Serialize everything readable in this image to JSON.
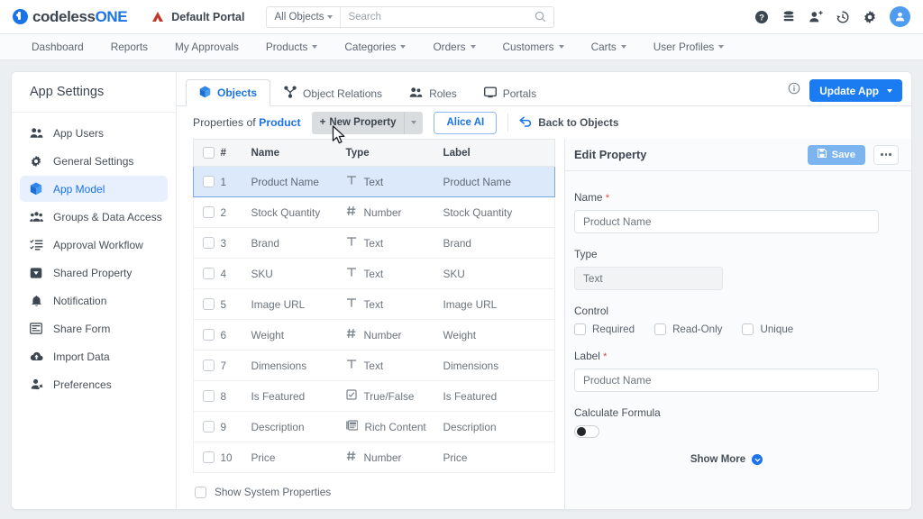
{
  "brand": {
    "name_part1": "codeless",
    "name_part2": "ONE",
    "accent": "#1a73e8"
  },
  "topbar": {
    "portal_name": "Default Portal",
    "search_scope": "All Objects",
    "search_placeholder": "Search",
    "search_value": "",
    "icons": [
      "help-icon",
      "database-icon",
      "add-user-icon",
      "history-icon",
      "gear-icon",
      "avatar"
    ]
  },
  "nav": {
    "items": [
      {
        "label": "Dashboard",
        "has_caret": false
      },
      {
        "label": "Reports",
        "has_caret": false
      },
      {
        "label": "My Approvals",
        "has_caret": false
      },
      {
        "label": "Products",
        "has_caret": true
      },
      {
        "label": "Categories",
        "has_caret": true
      },
      {
        "label": "Orders",
        "has_caret": true
      },
      {
        "label": "Customers",
        "has_caret": true
      },
      {
        "label": "Carts",
        "has_caret": true
      },
      {
        "label": "User Profiles",
        "has_caret": true
      }
    ]
  },
  "sidebar": {
    "title": "App Settings",
    "items": [
      {
        "label": "App Users",
        "icon": "users-icon",
        "active": false
      },
      {
        "label": "General Settings",
        "icon": "gear-icon",
        "active": false
      },
      {
        "label": "App Model",
        "icon": "cube-icon",
        "active": true
      },
      {
        "label": "Groups & Data Access",
        "icon": "group-icon",
        "active": false
      },
      {
        "label": "Approval Workflow",
        "icon": "checklist-icon",
        "active": false
      },
      {
        "label": "Shared Property",
        "icon": "tag-icon",
        "active": false
      },
      {
        "label": "Notification",
        "icon": "bell-icon",
        "active": false
      },
      {
        "label": "Share Form",
        "icon": "form-icon",
        "active": false
      },
      {
        "label": "Import Data",
        "icon": "cloud-upload-icon",
        "active": false
      },
      {
        "label": "Preferences",
        "icon": "person-gear-icon",
        "active": false
      }
    ]
  },
  "tabs": [
    {
      "label": "Objects",
      "icon": "cube-icon",
      "active": true
    },
    {
      "label": "Object Relations",
      "icon": "relations-icon",
      "active": false
    },
    {
      "label": "Roles",
      "icon": "users-icon",
      "active": false
    },
    {
      "label": "Portals",
      "icon": "monitor-icon",
      "active": false
    }
  ],
  "header_actions": {
    "info_icon": "info-icon",
    "update_app_label": "Update App"
  },
  "toolbar": {
    "properties_of": "Properties of",
    "object_name": "Product",
    "new_property_label": "New Property",
    "alice_ai_label": "Alice AI",
    "back_to_objects_label": "Back to Objects"
  },
  "table": {
    "columns": [
      "#",
      "Name",
      "Type",
      "Label"
    ],
    "rows": [
      {
        "num": "1",
        "name": "Product Name",
        "type": "Text",
        "type_icon": "text-icon",
        "label": "Product Name",
        "selected": true
      },
      {
        "num": "2",
        "name": "Stock Quantity",
        "type": "Number",
        "type_icon": "number-icon",
        "label": "Stock Quantity",
        "selected": false
      },
      {
        "num": "3",
        "name": "Brand",
        "type": "Text",
        "type_icon": "text-icon",
        "label": "Brand",
        "selected": false
      },
      {
        "num": "4",
        "name": "SKU",
        "type": "Text",
        "type_icon": "text-icon",
        "label": "SKU",
        "selected": false
      },
      {
        "num": "5",
        "name": "Image URL",
        "type": "Text",
        "type_icon": "text-icon",
        "label": "Image URL",
        "selected": false
      },
      {
        "num": "6",
        "name": "Weight",
        "type": "Number",
        "type_icon": "number-icon",
        "label": "Weight",
        "selected": false
      },
      {
        "num": "7",
        "name": "Dimensions",
        "type": "Text",
        "type_icon": "text-icon",
        "label": "Dimensions",
        "selected": false
      },
      {
        "num": "8",
        "name": "Is Featured",
        "type": "True/False",
        "type_icon": "checkbox-icon",
        "label": "Is Featured",
        "selected": false
      },
      {
        "num": "9",
        "name": "Description",
        "type": "Rich Content",
        "type_icon": "rich-content-icon",
        "label": "Description",
        "selected": false
      },
      {
        "num": "10",
        "name": "Price",
        "type": "Number",
        "type_icon": "number-icon",
        "label": "Price",
        "selected": false
      }
    ],
    "show_system_properties": "Show System Properties"
  },
  "edit_panel": {
    "title": "Edit Property",
    "save_label": "Save",
    "name_label": "Name",
    "name_value": "Product Name",
    "type_label": "Type",
    "type_value": "Text",
    "control_label": "Control",
    "controls": [
      {
        "label": "Required",
        "checked": false
      },
      {
        "label": "Read-Only",
        "checked": false
      },
      {
        "label": "Unique",
        "checked": false
      }
    ],
    "field_label_label": "Label",
    "field_label_value": "Product Name",
    "calculate_formula_label": "Calculate Formula",
    "calculate_formula_on": false,
    "show_more_label": "Show More"
  }
}
